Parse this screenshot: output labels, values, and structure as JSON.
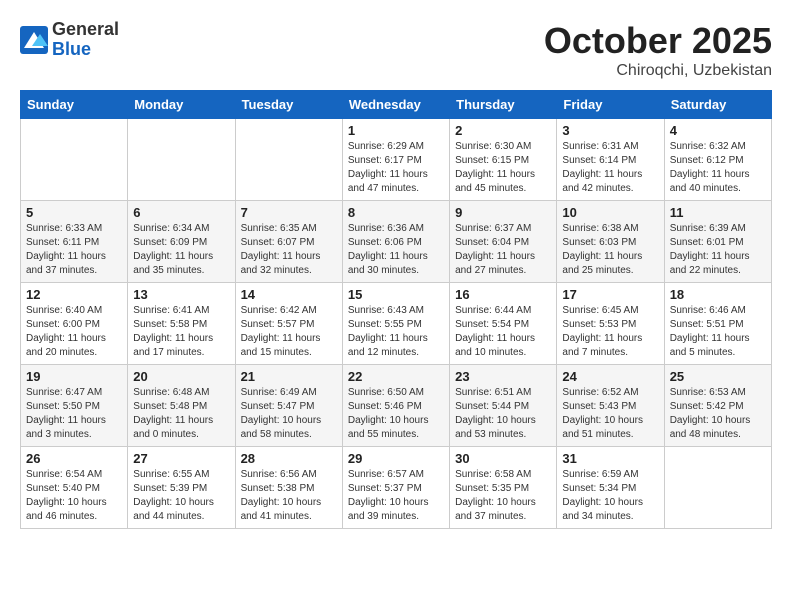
{
  "header": {
    "logo_general": "General",
    "logo_blue": "Blue",
    "month": "October 2025",
    "location": "Chiroqchi, Uzbekistan"
  },
  "weekdays": [
    "Sunday",
    "Monday",
    "Tuesday",
    "Wednesday",
    "Thursday",
    "Friday",
    "Saturday"
  ],
  "weeks": [
    [
      {
        "day": "",
        "info": ""
      },
      {
        "day": "",
        "info": ""
      },
      {
        "day": "",
        "info": ""
      },
      {
        "day": "1",
        "info": "Sunrise: 6:29 AM\nSunset: 6:17 PM\nDaylight: 11 hours\nand 47 minutes."
      },
      {
        "day": "2",
        "info": "Sunrise: 6:30 AM\nSunset: 6:15 PM\nDaylight: 11 hours\nand 45 minutes."
      },
      {
        "day": "3",
        "info": "Sunrise: 6:31 AM\nSunset: 6:14 PM\nDaylight: 11 hours\nand 42 minutes."
      },
      {
        "day": "4",
        "info": "Sunrise: 6:32 AM\nSunset: 6:12 PM\nDaylight: 11 hours\nand 40 minutes."
      }
    ],
    [
      {
        "day": "5",
        "info": "Sunrise: 6:33 AM\nSunset: 6:11 PM\nDaylight: 11 hours\nand 37 minutes."
      },
      {
        "day": "6",
        "info": "Sunrise: 6:34 AM\nSunset: 6:09 PM\nDaylight: 11 hours\nand 35 minutes."
      },
      {
        "day": "7",
        "info": "Sunrise: 6:35 AM\nSunset: 6:07 PM\nDaylight: 11 hours\nand 32 minutes."
      },
      {
        "day": "8",
        "info": "Sunrise: 6:36 AM\nSunset: 6:06 PM\nDaylight: 11 hours\nand 30 minutes."
      },
      {
        "day": "9",
        "info": "Sunrise: 6:37 AM\nSunset: 6:04 PM\nDaylight: 11 hours\nand 27 minutes."
      },
      {
        "day": "10",
        "info": "Sunrise: 6:38 AM\nSunset: 6:03 PM\nDaylight: 11 hours\nand 25 minutes."
      },
      {
        "day": "11",
        "info": "Sunrise: 6:39 AM\nSunset: 6:01 PM\nDaylight: 11 hours\nand 22 minutes."
      }
    ],
    [
      {
        "day": "12",
        "info": "Sunrise: 6:40 AM\nSunset: 6:00 PM\nDaylight: 11 hours\nand 20 minutes."
      },
      {
        "day": "13",
        "info": "Sunrise: 6:41 AM\nSunset: 5:58 PM\nDaylight: 11 hours\nand 17 minutes."
      },
      {
        "day": "14",
        "info": "Sunrise: 6:42 AM\nSunset: 5:57 PM\nDaylight: 11 hours\nand 15 minutes."
      },
      {
        "day": "15",
        "info": "Sunrise: 6:43 AM\nSunset: 5:55 PM\nDaylight: 11 hours\nand 12 minutes."
      },
      {
        "day": "16",
        "info": "Sunrise: 6:44 AM\nSunset: 5:54 PM\nDaylight: 11 hours\nand 10 minutes."
      },
      {
        "day": "17",
        "info": "Sunrise: 6:45 AM\nSunset: 5:53 PM\nDaylight: 11 hours\nand 7 minutes."
      },
      {
        "day": "18",
        "info": "Sunrise: 6:46 AM\nSunset: 5:51 PM\nDaylight: 11 hours\nand 5 minutes."
      }
    ],
    [
      {
        "day": "19",
        "info": "Sunrise: 6:47 AM\nSunset: 5:50 PM\nDaylight: 11 hours\nand 3 minutes."
      },
      {
        "day": "20",
        "info": "Sunrise: 6:48 AM\nSunset: 5:48 PM\nDaylight: 11 hours\nand 0 minutes."
      },
      {
        "day": "21",
        "info": "Sunrise: 6:49 AM\nSunset: 5:47 PM\nDaylight: 10 hours\nand 58 minutes."
      },
      {
        "day": "22",
        "info": "Sunrise: 6:50 AM\nSunset: 5:46 PM\nDaylight: 10 hours\nand 55 minutes."
      },
      {
        "day": "23",
        "info": "Sunrise: 6:51 AM\nSunset: 5:44 PM\nDaylight: 10 hours\nand 53 minutes."
      },
      {
        "day": "24",
        "info": "Sunrise: 6:52 AM\nSunset: 5:43 PM\nDaylight: 10 hours\nand 51 minutes."
      },
      {
        "day": "25",
        "info": "Sunrise: 6:53 AM\nSunset: 5:42 PM\nDaylight: 10 hours\nand 48 minutes."
      }
    ],
    [
      {
        "day": "26",
        "info": "Sunrise: 6:54 AM\nSunset: 5:40 PM\nDaylight: 10 hours\nand 46 minutes."
      },
      {
        "day": "27",
        "info": "Sunrise: 6:55 AM\nSunset: 5:39 PM\nDaylight: 10 hours\nand 44 minutes."
      },
      {
        "day": "28",
        "info": "Sunrise: 6:56 AM\nSunset: 5:38 PM\nDaylight: 10 hours\nand 41 minutes."
      },
      {
        "day": "29",
        "info": "Sunrise: 6:57 AM\nSunset: 5:37 PM\nDaylight: 10 hours\nand 39 minutes."
      },
      {
        "day": "30",
        "info": "Sunrise: 6:58 AM\nSunset: 5:35 PM\nDaylight: 10 hours\nand 37 minutes."
      },
      {
        "day": "31",
        "info": "Sunrise: 6:59 AM\nSunset: 5:34 PM\nDaylight: 10 hours\nand 34 minutes."
      },
      {
        "day": "",
        "info": ""
      }
    ]
  ]
}
